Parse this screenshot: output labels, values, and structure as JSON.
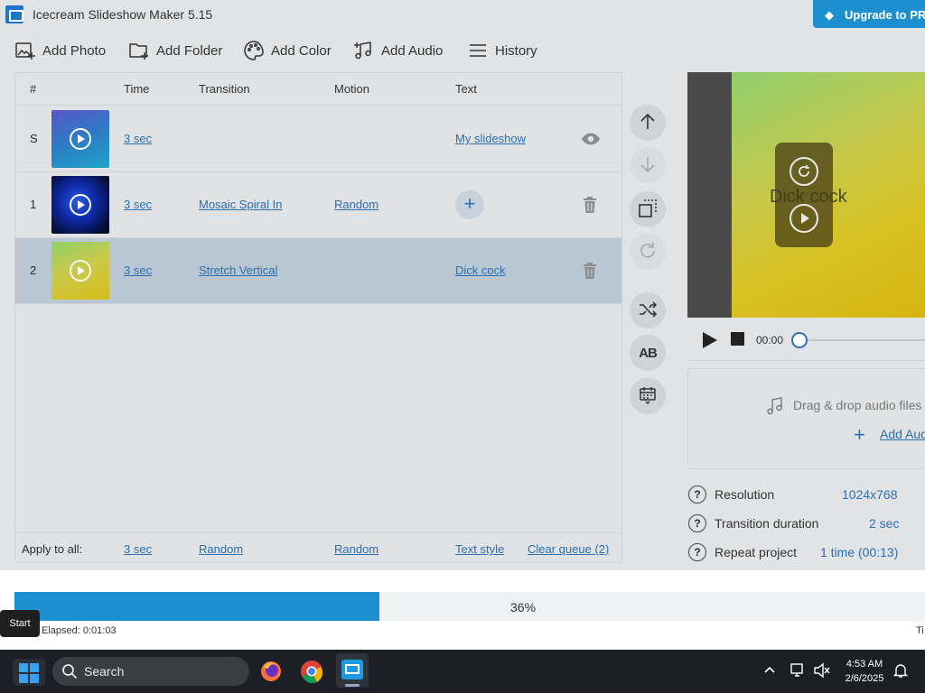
{
  "app": {
    "title": "Icecream Slideshow Maker 5.15",
    "upgrade_label": "Upgrade to PRO"
  },
  "toolbar": {
    "add_photo": "Add Photo",
    "add_folder": "Add Folder",
    "add_color": "Add Color",
    "add_audio": "Add Audio",
    "history": "History"
  },
  "queue": {
    "headers": {
      "num": "#",
      "time": "Time",
      "transition": "Transition",
      "motion": "Motion",
      "text": "Text"
    },
    "rows": [
      {
        "num": "S",
        "time": "3 sec",
        "transition": "",
        "motion": "",
        "text": "My slideshow",
        "thumb": "blue-gradient",
        "action_icon": "eye-icon"
      },
      {
        "num": "1",
        "time": "3 sec",
        "transition": "Mosaic Spiral In",
        "motion": "Random",
        "text": "",
        "thumb": "blue-jellyfish",
        "action_icon": "trash-icon"
      },
      {
        "num": "2",
        "time": "3 sec",
        "transition": "Stretch Vertical",
        "motion": "",
        "text": "Dick cock",
        "thumb": "yellow-green-gradient",
        "action_icon": "trash-icon"
      }
    ],
    "footer": {
      "apply_label": "Apply to all:",
      "time": "3 sec",
      "transition": "Random",
      "motion": "Random",
      "text_style": "Text style",
      "clear_queue": "Clear queue (2)"
    }
  },
  "preview": {
    "overlay_text": "Dick cock",
    "time": "00:00"
  },
  "audio": {
    "drop_text": "Drag & drop audio files here",
    "add_audio": "Add Audio"
  },
  "properties": [
    {
      "label": "Resolution",
      "value": "1024x768"
    },
    {
      "label": "Transition duration",
      "value": "2 sec"
    },
    {
      "label": "Repeat project",
      "value": "1 time (00:13)"
    }
  ],
  "progress": {
    "percent": 36,
    "percent_label": "36%",
    "elapsed": "Elapsed: 0:01:03",
    "right_label": "Ti"
  },
  "taskbar": {
    "start_tooltip": "Start",
    "search_label": "Search",
    "time": "4:53 AM",
    "date": "2/6/2025"
  },
  "colors": {
    "accent": "#1c8fd0",
    "link": "#2a6fb0",
    "selected_row": "#b9c7d2"
  }
}
